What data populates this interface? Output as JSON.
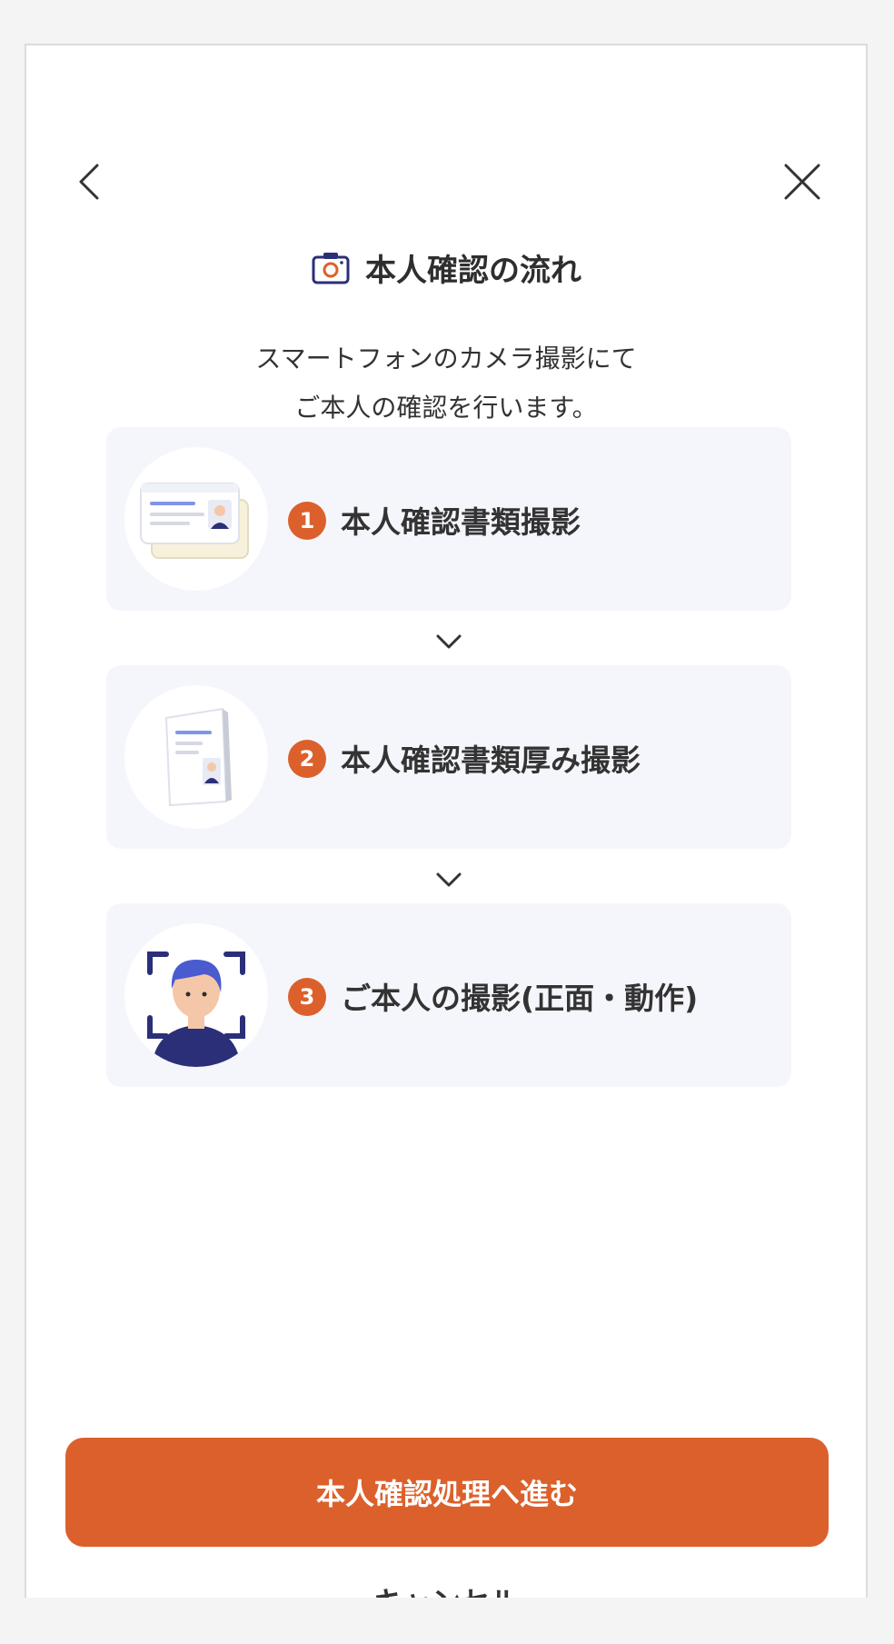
{
  "header": {
    "back_icon": "chevron-left-icon",
    "close_icon": "close-icon"
  },
  "title": {
    "icon": "camera-icon",
    "text": "本人確認の流れ"
  },
  "subtitle": {
    "line1": "スマートフォンのカメラ撮影にて",
    "line2": "ご本人の確認を行います。"
  },
  "steps": [
    {
      "number": "1",
      "label": "本人確認書類撮影",
      "icon": "id-card-icon"
    },
    {
      "number": "2",
      "label": "本人確認書類厚み撮影",
      "icon": "id-card-thickness-icon"
    },
    {
      "number": "3",
      "label": "ご本人の撮影(正面・動作)",
      "icon": "face-scan-icon"
    }
  ],
  "actions": {
    "primary_label": "本人確認処理へ進む",
    "cancel_label": "キャンセル"
  },
  "colors": {
    "accent": "#dc602b",
    "card_bg": "#f5f6fc",
    "navy": "#2b2f78"
  }
}
